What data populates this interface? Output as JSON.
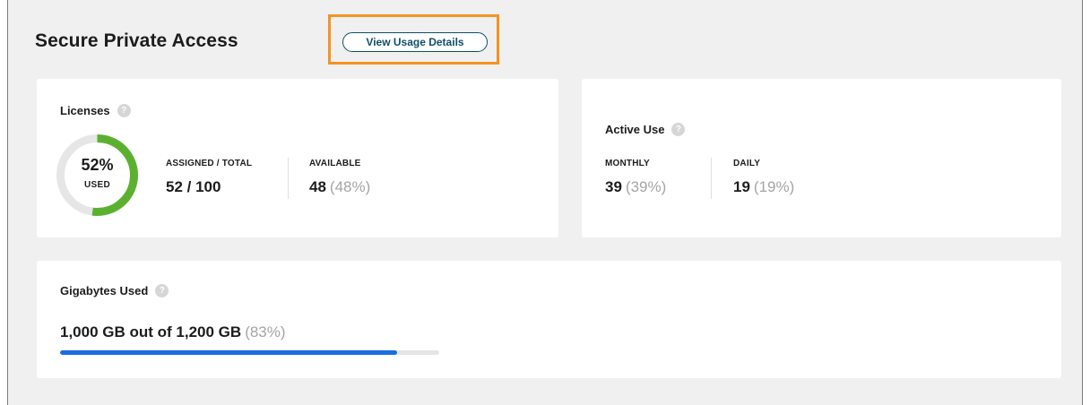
{
  "page": {
    "title": "Secure Private Access",
    "view_usage_button": "View Usage Details"
  },
  "licenses": {
    "heading": "Licenses",
    "help_icon": "?",
    "used_percent": 52,
    "donut_text": "52%",
    "donut_sub": "USED",
    "assigned_label": "ASSIGNED / TOTAL",
    "assigned_value": "52 / 100",
    "available_label": "AVAILABLE",
    "available_value": "48",
    "available_pct": "(48%)"
  },
  "active_use": {
    "heading": "Active Use",
    "help_icon": "?",
    "monthly_label": "MONTHLY",
    "monthly_value": "39",
    "monthly_pct": "(39%)",
    "daily_label": "DAILY",
    "daily_value": "19",
    "daily_pct": "(19%)"
  },
  "gigabytes": {
    "heading": "Gigabytes Used",
    "help_icon": "?",
    "summary": "1,000 GB out of 1,200 GB",
    "summary_pct": "(83%)",
    "used_fraction": 0.89
  },
  "colors": {
    "accent_teal": "#0e4f66",
    "highlight_orange": "#f5931f",
    "donut_green": "#5bb12f",
    "bar_blue": "#1a6de0",
    "track_gray": "#e5e5e5"
  },
  "icons": [
    "help-icon",
    "donut-chart-icon"
  ]
}
